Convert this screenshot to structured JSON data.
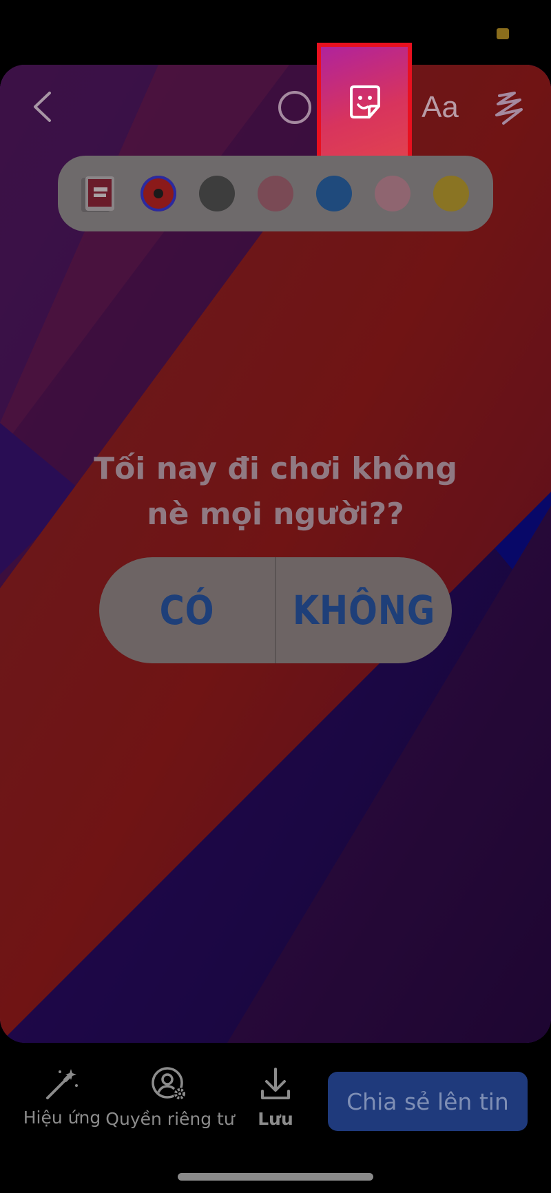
{
  "toolbar": {
    "back_icon": "chevron-left-icon",
    "circle_icon": "circle-icon",
    "sticker_icon": "sticker-icon",
    "text_tool_label": "Aa",
    "draw_icon": "squiggle-draw-icon",
    "selected_tool": "sticker",
    "highlight_color": "#e8101f"
  },
  "palette": {
    "items": [
      {
        "kind": "thumbnail"
      },
      {
        "kind": "color",
        "color": "#8b1a1a"
      },
      {
        "kind": "color",
        "color": "#3d3d3d"
      },
      {
        "kind": "color",
        "color": "#7a4a55"
      },
      {
        "kind": "color",
        "color": "#1f4a7c"
      },
      {
        "kind": "color",
        "color": "#8f6570"
      },
      {
        "kind": "color",
        "color": "#8a7423"
      }
    ]
  },
  "poll": {
    "question_line1": "Tối nay đi chơi không",
    "question_line2": "nè mọi người??",
    "option_yes": "CÓ",
    "option_no": "KHÔNG"
  },
  "bottom": {
    "effects_label": "Hiệu ứng",
    "privacy_label": "Quyền riêng tư",
    "save_label": "Lưu",
    "share_label": "Chia sẻ lên tin"
  },
  "colors": {
    "canvas_red": "#d92b2b",
    "canvas_purple": "#4a1468",
    "poll_text": "#1e3f79",
    "share_button": "#1f3a7c"
  }
}
